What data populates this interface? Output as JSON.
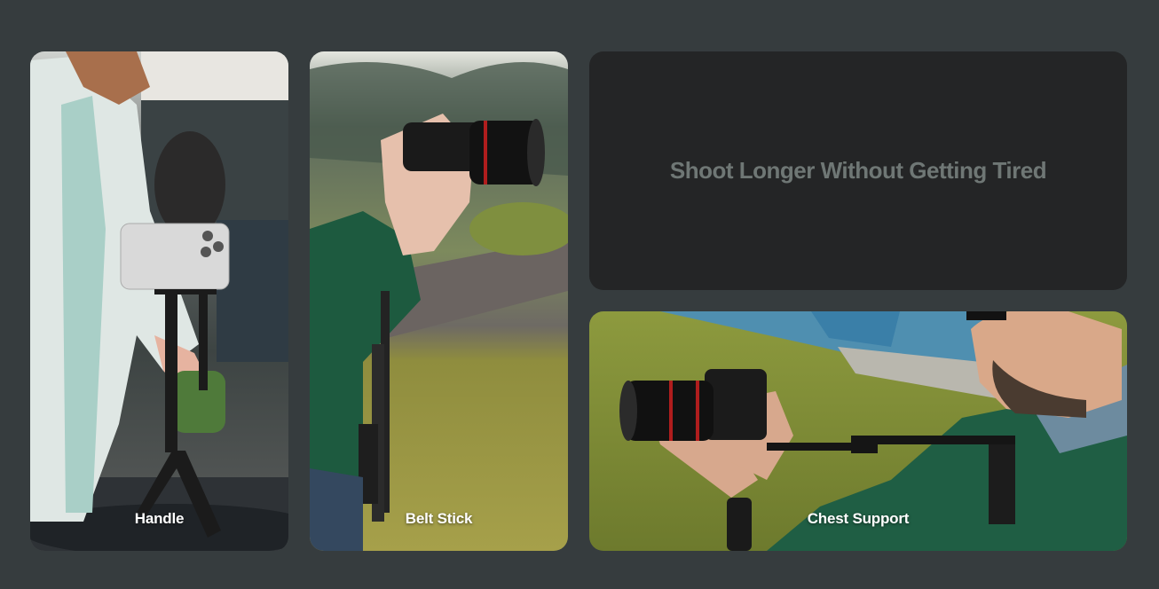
{
  "cards": [
    {
      "caption": "Handle"
    },
    {
      "caption": "Belt Stick"
    },
    {
      "caption": "Chest Support"
    }
  ],
  "headline": "Shoot Longer Without Getting Tired"
}
